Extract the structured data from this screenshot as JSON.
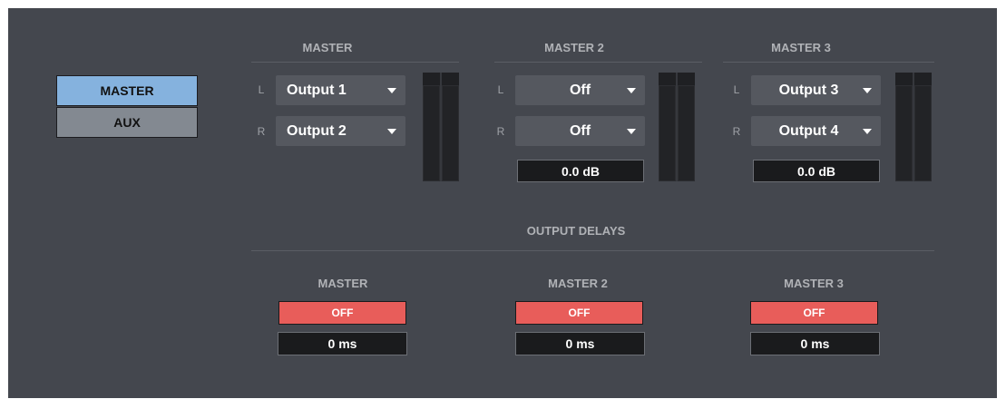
{
  "tabs": [
    {
      "label": "MASTER",
      "active": true
    },
    {
      "label": "AUX",
      "active": false
    }
  ],
  "outputs": [
    {
      "title": "MASTER",
      "left_channel": "L",
      "right_channel": "R",
      "left_value": "Output 1",
      "right_value": "Output 2",
      "gain": null
    },
    {
      "title": "MASTER 2",
      "left_channel": "L",
      "right_channel": "R",
      "left_value": "Off",
      "right_value": "Off",
      "gain": "0.0 dB"
    },
    {
      "title": "MASTER 3",
      "left_channel": "L",
      "right_channel": "R",
      "left_value": "Output 3",
      "right_value": "Output 4",
      "gain": "0.0 dB"
    }
  ],
  "output_delays": {
    "title": "OUTPUT DELAYS",
    "items": [
      {
        "title": "MASTER",
        "toggle": "OFF",
        "delay": "0 ms"
      },
      {
        "title": "MASTER 2",
        "toggle": "OFF",
        "delay": "0 ms"
      },
      {
        "title": "MASTER 3",
        "toggle": "OFF",
        "delay": "0 ms"
      }
    ]
  },
  "colors": {
    "panel_bg": "#44474e",
    "tab_active": "#85b2de",
    "tab_inactive": "#838991",
    "dropdown_bg": "#55585f",
    "off_button": "#e85d5a",
    "field_bg": "#1a1b1d"
  }
}
